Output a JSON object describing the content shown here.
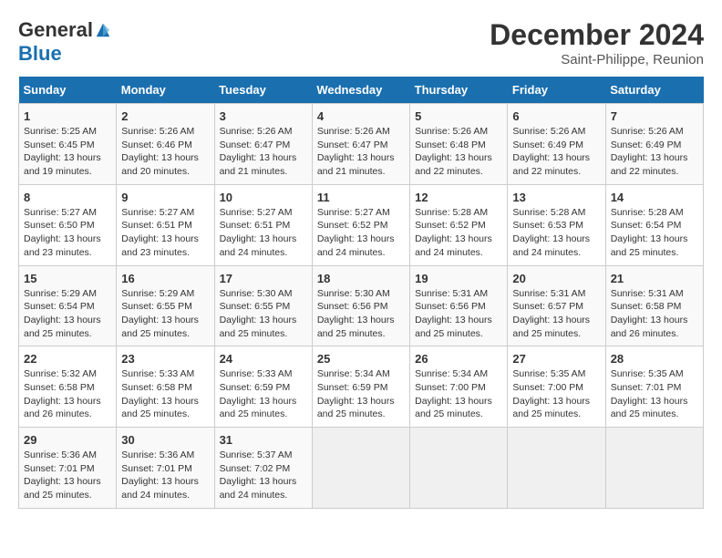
{
  "header": {
    "logo_general": "General",
    "logo_blue": "Blue",
    "month": "December 2024",
    "location": "Saint-Philippe, Reunion"
  },
  "days_of_week": [
    "Sunday",
    "Monday",
    "Tuesday",
    "Wednesday",
    "Thursday",
    "Friday",
    "Saturday"
  ],
  "weeks": [
    [
      {
        "day": "1",
        "sunrise": "Sunrise: 5:25 AM",
        "sunset": "Sunset: 6:45 PM",
        "daylight": "Daylight: 13 hours and 19 minutes."
      },
      {
        "day": "2",
        "sunrise": "Sunrise: 5:26 AM",
        "sunset": "Sunset: 6:46 PM",
        "daylight": "Daylight: 13 hours and 20 minutes."
      },
      {
        "day": "3",
        "sunrise": "Sunrise: 5:26 AM",
        "sunset": "Sunset: 6:47 PM",
        "daylight": "Daylight: 13 hours and 21 minutes."
      },
      {
        "day": "4",
        "sunrise": "Sunrise: 5:26 AM",
        "sunset": "Sunset: 6:47 PM",
        "daylight": "Daylight: 13 hours and 21 minutes."
      },
      {
        "day": "5",
        "sunrise": "Sunrise: 5:26 AM",
        "sunset": "Sunset: 6:48 PM",
        "daylight": "Daylight: 13 hours and 22 minutes."
      },
      {
        "day": "6",
        "sunrise": "Sunrise: 5:26 AM",
        "sunset": "Sunset: 6:49 PM",
        "daylight": "Daylight: 13 hours and 22 minutes."
      },
      {
        "day": "7",
        "sunrise": "Sunrise: 5:26 AM",
        "sunset": "Sunset: 6:49 PM",
        "daylight": "Daylight: 13 hours and 22 minutes."
      }
    ],
    [
      {
        "day": "8",
        "sunrise": "Sunrise: 5:27 AM",
        "sunset": "Sunset: 6:50 PM",
        "daylight": "Daylight: 13 hours and 23 minutes."
      },
      {
        "day": "9",
        "sunrise": "Sunrise: 5:27 AM",
        "sunset": "Sunset: 6:51 PM",
        "daylight": "Daylight: 13 hours and 23 minutes."
      },
      {
        "day": "10",
        "sunrise": "Sunrise: 5:27 AM",
        "sunset": "Sunset: 6:51 PM",
        "daylight": "Daylight: 13 hours and 24 minutes."
      },
      {
        "day": "11",
        "sunrise": "Sunrise: 5:27 AM",
        "sunset": "Sunset: 6:52 PM",
        "daylight": "Daylight: 13 hours and 24 minutes."
      },
      {
        "day": "12",
        "sunrise": "Sunrise: 5:28 AM",
        "sunset": "Sunset: 6:52 PM",
        "daylight": "Daylight: 13 hours and 24 minutes."
      },
      {
        "day": "13",
        "sunrise": "Sunrise: 5:28 AM",
        "sunset": "Sunset: 6:53 PM",
        "daylight": "Daylight: 13 hours and 24 minutes."
      },
      {
        "day": "14",
        "sunrise": "Sunrise: 5:28 AM",
        "sunset": "Sunset: 6:54 PM",
        "daylight": "Daylight: 13 hours and 25 minutes."
      }
    ],
    [
      {
        "day": "15",
        "sunrise": "Sunrise: 5:29 AM",
        "sunset": "Sunset: 6:54 PM",
        "daylight": "Daylight: 13 hours and 25 minutes."
      },
      {
        "day": "16",
        "sunrise": "Sunrise: 5:29 AM",
        "sunset": "Sunset: 6:55 PM",
        "daylight": "Daylight: 13 hours and 25 minutes."
      },
      {
        "day": "17",
        "sunrise": "Sunrise: 5:30 AM",
        "sunset": "Sunset: 6:55 PM",
        "daylight": "Daylight: 13 hours and 25 minutes."
      },
      {
        "day": "18",
        "sunrise": "Sunrise: 5:30 AM",
        "sunset": "Sunset: 6:56 PM",
        "daylight": "Daylight: 13 hours and 25 minutes."
      },
      {
        "day": "19",
        "sunrise": "Sunrise: 5:31 AM",
        "sunset": "Sunset: 6:56 PM",
        "daylight": "Daylight: 13 hours and 25 minutes."
      },
      {
        "day": "20",
        "sunrise": "Sunrise: 5:31 AM",
        "sunset": "Sunset: 6:57 PM",
        "daylight": "Daylight: 13 hours and 25 minutes."
      },
      {
        "day": "21",
        "sunrise": "Sunrise: 5:31 AM",
        "sunset": "Sunset: 6:58 PM",
        "daylight": "Daylight: 13 hours and 26 minutes."
      }
    ],
    [
      {
        "day": "22",
        "sunrise": "Sunrise: 5:32 AM",
        "sunset": "Sunset: 6:58 PM",
        "daylight": "Daylight: 13 hours and 26 minutes."
      },
      {
        "day": "23",
        "sunrise": "Sunrise: 5:33 AM",
        "sunset": "Sunset: 6:58 PM",
        "daylight": "Daylight: 13 hours and 25 minutes."
      },
      {
        "day": "24",
        "sunrise": "Sunrise: 5:33 AM",
        "sunset": "Sunset: 6:59 PM",
        "daylight": "Daylight: 13 hours and 25 minutes."
      },
      {
        "day": "25",
        "sunrise": "Sunrise: 5:34 AM",
        "sunset": "Sunset: 6:59 PM",
        "daylight": "Daylight: 13 hours and 25 minutes."
      },
      {
        "day": "26",
        "sunrise": "Sunrise: 5:34 AM",
        "sunset": "Sunset: 7:00 PM",
        "daylight": "Daylight: 13 hours and 25 minutes."
      },
      {
        "day": "27",
        "sunrise": "Sunrise: 5:35 AM",
        "sunset": "Sunset: 7:00 PM",
        "daylight": "Daylight: 13 hours and 25 minutes."
      },
      {
        "day": "28",
        "sunrise": "Sunrise: 5:35 AM",
        "sunset": "Sunset: 7:01 PM",
        "daylight": "Daylight: 13 hours and 25 minutes."
      }
    ],
    [
      {
        "day": "29",
        "sunrise": "Sunrise: 5:36 AM",
        "sunset": "Sunset: 7:01 PM",
        "daylight": "Daylight: 13 hours and 25 minutes."
      },
      {
        "day": "30",
        "sunrise": "Sunrise: 5:36 AM",
        "sunset": "Sunset: 7:01 PM",
        "daylight": "Daylight: 13 hours and 24 minutes."
      },
      {
        "day": "31",
        "sunrise": "Sunrise: 5:37 AM",
        "sunset": "Sunset: 7:02 PM",
        "daylight": "Daylight: 13 hours and 24 minutes."
      },
      null,
      null,
      null,
      null
    ]
  ]
}
